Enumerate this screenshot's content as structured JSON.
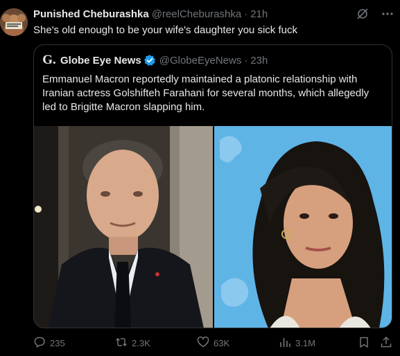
{
  "tweet": {
    "author_name": "Punished Cheburashka",
    "author_handle": "@reelCheburashka",
    "separator": "·",
    "time": "21h",
    "text": "She's old enough to be your wife's daughter you sick fuck"
  },
  "quote": {
    "logo_letter": "G.",
    "author_name": "Globe Eye News",
    "author_handle": "@GlobeEyeNews",
    "separator": "·",
    "time": "23h",
    "text": "Emmanuel Macron reportedly maintained a platonic relationship with Iranian actress Golshifteh Farahani for several months, which allegedly led to Brigitte Macron slapping him."
  },
  "actions": {
    "reply_count": "235",
    "retweet_count": "2.3K",
    "like_count": "63K",
    "view_count": "3.1M"
  },
  "icons": {
    "avatar": "avatar-image",
    "grok": "grok-icon",
    "more": "more-icon",
    "verified": "verified-badge-icon",
    "reply": "reply-icon",
    "retweet": "retweet-icon",
    "like": "heart-icon",
    "views": "views-icon",
    "bookmark": "bookmark-icon",
    "share": "share-icon"
  },
  "colors": {
    "background": "#000000",
    "text_primary": "#e7e9ea",
    "text_secondary": "#71767b",
    "border": "#2f3336",
    "verified_blue": "#1d9bf0"
  }
}
